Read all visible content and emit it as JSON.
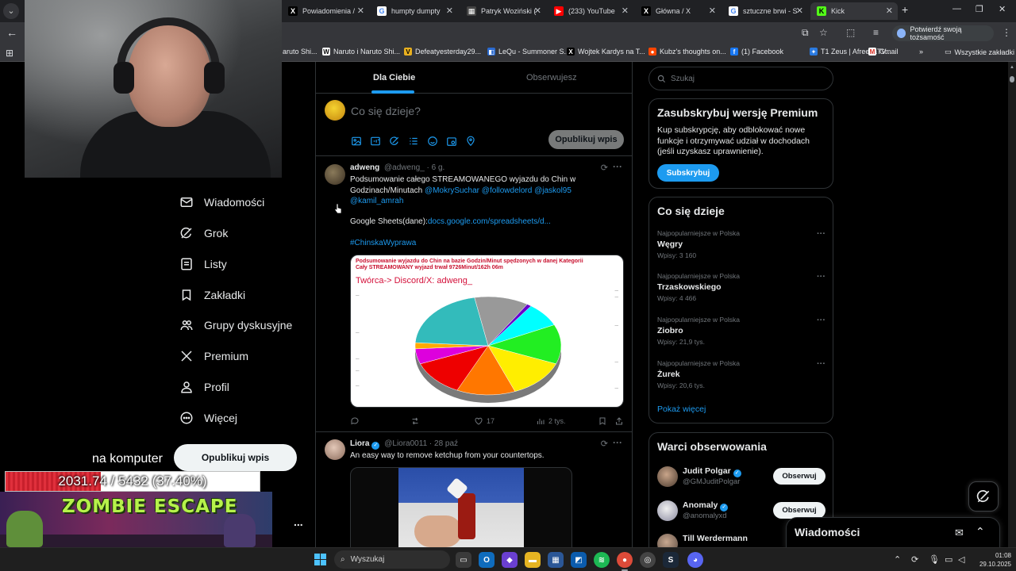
{
  "browser": {
    "tabs": [
      {
        "label": "Powiadomienia /",
        "icon": "x-logo-icon",
        "color": "#000000"
      },
      {
        "label": "humpty dumpty",
        "icon": "google-icon",
        "color": "#ffffff"
      },
      {
        "label": "Patryk Woziński (",
        "icon": "generic-page-icon",
        "color": "#444444"
      },
      {
        "label": "(233) YouTube",
        "icon": "youtube-icon",
        "color": "#ff0000"
      },
      {
        "label": "Główna / X",
        "icon": "x-logo-icon",
        "color": "#000000"
      },
      {
        "label": "sztuczne brwi - S",
        "icon": "google-icon",
        "color": "#ffffff"
      },
      {
        "label": "Kick",
        "icon": "kick-icon",
        "color": "#53fc18"
      }
    ],
    "verify_label": "Potwierdź swoją tożsamość",
    "bookmarks": [
      {
        "label": "aruto Shi...",
        "icon": "none"
      },
      {
        "label": "Naruto i Naruto Shi...",
        "icon": "w-icon"
      },
      {
        "label": "Defeatyesterday29...",
        "icon": "v-icon"
      },
      {
        "label": "LeQu - Summoner S...",
        "icon": "lol-icon"
      },
      {
        "label": "Wojtek Kardys na T...",
        "icon": "x-logo-icon"
      },
      {
        "label": "Kubz's thoughts on...",
        "icon": "reddit-icon"
      },
      {
        "label": "(1) Facebook",
        "icon": "facebook-icon"
      },
      {
        "label": "T1 Zeus | AfreecaTV...",
        "icon": "afreeca-icon"
      },
      {
        "label": "Gmail",
        "icon": "gmail-icon"
      }
    ],
    "bookmarks_folder": "Wszystkie zakładki"
  },
  "nav": {
    "items": [
      {
        "label": "Wiadomości",
        "icon": "mail-icon"
      },
      {
        "label": "Grok",
        "icon": "grok-icon"
      },
      {
        "label": "Listy",
        "icon": "list-icon"
      },
      {
        "label": "Zakładki",
        "icon": "bookmark-icon"
      },
      {
        "label": "Grupy dyskusyjne",
        "icon": "people-icon"
      },
      {
        "label": "Premium",
        "icon": "x-logo-icon"
      },
      {
        "label": "Profil",
        "icon": "profile-icon"
      },
      {
        "label": "Więcej",
        "icon": "more-circle-icon"
      }
    ],
    "post_button": "Opublikuj wpis"
  },
  "stream_overlay": {
    "text": "na komputer",
    "progress_text": "2031.74 / 5432 (37.40%)",
    "progress_fraction": 0.374,
    "game_title": "ZOMBIE ESCAPE",
    "more": "..."
  },
  "feed": {
    "tabs": [
      "Dla Ciebie",
      "Obserwujesz"
    ],
    "compose_placeholder": "Co się dzieje?",
    "compose_post_button": "Opublikuj wpis",
    "tweets": [
      {
        "name": "adweng",
        "handle": "@adweng_",
        "time": "· 6 g.",
        "text_plain": "Podsumowanie całego STREAMOWANEGO wyjazdu do Chin w Godzinach/Minutach",
        "mentions": "@MokrySuchar @followdelord @jaskol95 @kamil_amrah",
        "sheet_prefix": "Google Sheets(dane):",
        "sheet_link": "docs.google.com/spreadsheets/d...",
        "hashtag": "#ChinskaWyprawa",
        "image_title": "Podsumowanie wyjazdu do Chin na bazie Godzin/Minut spędzonych w danej Kategorii Cały STREAMOWANY wyjazd trwał 9726Minut/162h 06m",
        "image_author": "Twórca-> Discord/X: adweng_",
        "replies": "",
        "retweets": "",
        "likes": "17",
        "views": "2 tys."
      },
      {
        "name": "Liora",
        "handle": "@Liora0011",
        "time": "· 28 paź",
        "text": "An easy way to remove ketchup from your countertops."
      }
    ]
  },
  "sidebar": {
    "search_placeholder": "Szukaj",
    "premium": {
      "title": "Zasubskrybuj wersję Premium",
      "desc": "Kup subskrypcję, aby odblokować nowe funkcje i otrzymywać udział w dochodach (jeśli uzyskasz uprawnienie).",
      "button": "Subskrybuj"
    },
    "trends": {
      "title": "Co się dzieje",
      "items": [
        {
          "meta": "Najpopularniejsze w Polska",
          "name": "Węgry",
          "posts": "Wpisy: 3 160"
        },
        {
          "meta": "Najpopularniejsze w Polska",
          "name": "Trzaskowskiego",
          "posts": "Wpisy: 4 466"
        },
        {
          "meta": "Najpopularniejsze w Polska",
          "name": "Ziobro",
          "posts": "Wpisy: 21,9 tys."
        },
        {
          "meta": "Najpopularniejsze w Polska",
          "name": "Żurek",
          "posts": "Wpisy: 20,6 tys."
        }
      ],
      "show_more": "Pokaż więcej"
    },
    "who_to_follow": {
      "title": "Warci obserwowania",
      "items": [
        {
          "name": "Judit Polgar",
          "handle": "@GMJuditPolgar",
          "button": "Obserwuj"
        },
        {
          "name": "Anomaly",
          "handle": "@anomalyxd",
          "button": "Obserwuj"
        },
        {
          "name": "Till Werdermann",
          "handle": "",
          "button": ""
        }
      ]
    }
  },
  "messages_drawer": {
    "title": "Wiadomości"
  },
  "taskbar": {
    "search_placeholder": "Wyszukaj",
    "time": "01:08",
    "date": "29.10.2025"
  }
}
